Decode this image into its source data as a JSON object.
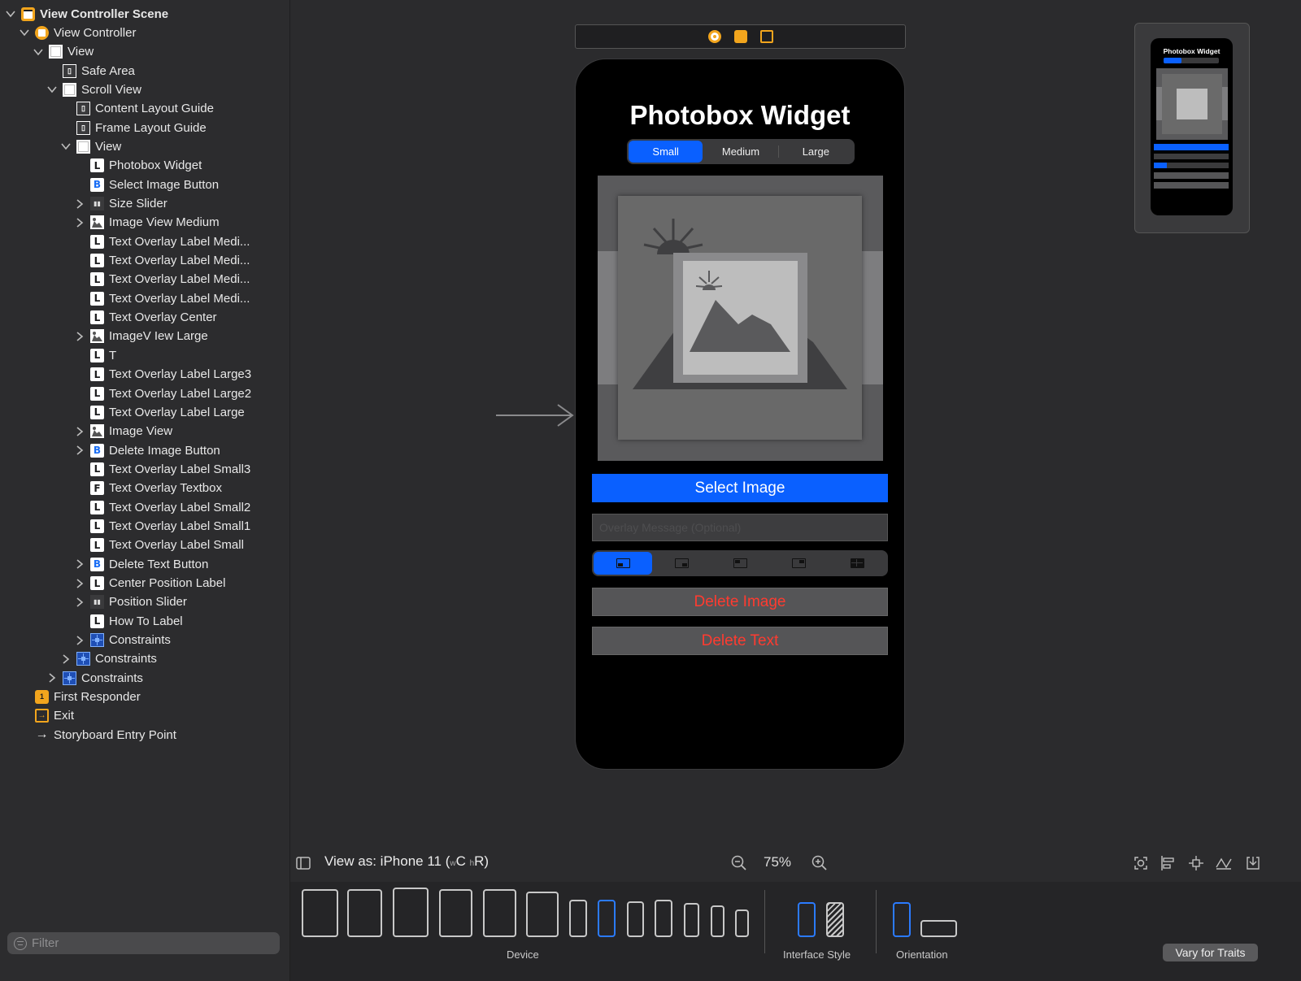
{
  "outline": {
    "items": [
      {
        "label": "View Controller Scene",
        "icon": "scene-icon",
        "kind": "scene",
        "depth": 0,
        "chevron": "down",
        "bold": true
      },
      {
        "label": "View Controller",
        "icon": "view-controller-icon",
        "kind": "vc",
        "depth": 1,
        "chevron": "down"
      },
      {
        "label": "View",
        "icon": "view-icon",
        "kind": "view",
        "depth": 2,
        "chevron": "down"
      },
      {
        "label": "Safe Area",
        "icon": "guide-icon",
        "kind": "guide",
        "depth": 3,
        "chevron": "none"
      },
      {
        "label": "Scroll View",
        "icon": "view-icon",
        "kind": "view",
        "depth": 3,
        "chevron": "down"
      },
      {
        "label": "Content Layout Guide",
        "icon": "guide-icon",
        "kind": "guide",
        "depth": 4,
        "chevron": "none"
      },
      {
        "label": "Frame Layout Guide",
        "icon": "guide-icon",
        "kind": "guide",
        "depth": 4,
        "chevron": "none"
      },
      {
        "label": "View",
        "icon": "view-icon",
        "kind": "view",
        "depth": 4,
        "chevron": "down"
      },
      {
        "label": "Photobox Widget",
        "icon": "label-icon",
        "kind": "label",
        "depth": 5,
        "chevron": "none"
      },
      {
        "label": "Select Image Button",
        "icon": "button-icon",
        "kind": "button",
        "depth": 5,
        "chevron": "none"
      },
      {
        "label": "Size Slider",
        "icon": "slider-icon",
        "kind": "slider",
        "depth": 5,
        "chevron": "right"
      },
      {
        "label": "Image View Medium",
        "icon": "image-view-icon",
        "kind": "imageview",
        "depth": 5,
        "chevron": "right"
      },
      {
        "label": "Text Overlay Label Medi...",
        "icon": "label-icon",
        "kind": "label",
        "depth": 5,
        "chevron": "none"
      },
      {
        "label": "Text Overlay Label Medi...",
        "icon": "label-icon",
        "kind": "label",
        "depth": 5,
        "chevron": "none"
      },
      {
        "label": "Text Overlay Label Medi...",
        "icon": "label-icon",
        "kind": "label",
        "depth": 5,
        "chevron": "none"
      },
      {
        "label": "Text Overlay Label Medi...",
        "icon": "label-icon",
        "kind": "label",
        "depth": 5,
        "chevron": "none"
      },
      {
        "label": "Text Overlay Center",
        "icon": "label-icon",
        "kind": "label",
        "depth": 5,
        "chevron": "none"
      },
      {
        "label": "ImageV Iew Large",
        "icon": "image-view-icon",
        "kind": "imageview",
        "depth": 5,
        "chevron": "right"
      },
      {
        "label": "T",
        "icon": "label-icon",
        "kind": "label",
        "depth": 5,
        "chevron": "none"
      },
      {
        "label": "Text Overlay Label Large3",
        "icon": "label-icon",
        "kind": "label",
        "depth": 5,
        "chevron": "none"
      },
      {
        "label": "Text Overlay Label Large2",
        "icon": "label-icon",
        "kind": "label",
        "depth": 5,
        "chevron": "none"
      },
      {
        "label": "Text Overlay Label Large",
        "icon": "label-icon",
        "kind": "label",
        "depth": 5,
        "chevron": "none"
      },
      {
        "label": "Image View",
        "icon": "image-view-icon",
        "kind": "imageview",
        "depth": 5,
        "chevron": "right"
      },
      {
        "label": "Delete Image Button",
        "icon": "button-icon",
        "kind": "button",
        "depth": 5,
        "chevron": "right"
      },
      {
        "label": "Text Overlay Label Small3",
        "icon": "label-icon",
        "kind": "label",
        "depth": 5,
        "chevron": "none"
      },
      {
        "label": "Text Overlay Textbox",
        "icon": "textfield-icon",
        "kind": "textfield",
        "depth": 5,
        "chevron": "none"
      },
      {
        "label": "Text Overlay Label Small2",
        "icon": "label-icon",
        "kind": "label",
        "depth": 5,
        "chevron": "none"
      },
      {
        "label": "Text Overlay Label Small1",
        "icon": "label-icon",
        "kind": "label",
        "depth": 5,
        "chevron": "none"
      },
      {
        "label": "Text Overlay Label Small",
        "icon": "label-icon",
        "kind": "label",
        "depth": 5,
        "chevron": "none"
      },
      {
        "label": "Delete Text Button",
        "icon": "button-icon",
        "kind": "button",
        "depth": 5,
        "chevron": "right"
      },
      {
        "label": "Center Position Label",
        "icon": "label-icon",
        "kind": "label",
        "depth": 5,
        "chevron": "right"
      },
      {
        "label": "Position Slider",
        "icon": "slider-icon",
        "kind": "slider",
        "depth": 5,
        "chevron": "right"
      },
      {
        "label": "How To Label",
        "icon": "label-icon",
        "kind": "label",
        "depth": 5,
        "chevron": "none"
      },
      {
        "label": "Constraints",
        "icon": "constraints-icon",
        "kind": "constraints",
        "depth": 5,
        "chevron": "right"
      },
      {
        "label": "Constraints",
        "icon": "constraints-icon",
        "kind": "constraints",
        "depth": 4,
        "chevron": "right"
      },
      {
        "label": "Constraints",
        "icon": "constraints-icon",
        "kind": "constraints",
        "depth": 3,
        "chevron": "right"
      },
      {
        "label": "First Responder",
        "icon": "first-responder-icon",
        "kind": "responder",
        "depth": 1,
        "chevron": "none"
      },
      {
        "label": "Exit",
        "icon": "exit-icon",
        "kind": "exit",
        "depth": 1,
        "chevron": "none"
      },
      {
        "label": "Storyboard Entry Point",
        "icon": "entry-arrow-icon",
        "kind": "entry",
        "depth": 1,
        "chevron": "none"
      }
    ],
    "filter_placeholder": "Filter"
  },
  "phone": {
    "title": "Photobox Widget",
    "size_segments": [
      "Small",
      "Medium",
      "Large"
    ],
    "size_selected": "Small",
    "select_image_label": "Select Image",
    "overlay_placeholder": "Overlay Message (Optional)",
    "position_selected_index": 0,
    "delete_image_label": "Delete Image",
    "delete_text_label": "Delete Text"
  },
  "minimap": {
    "title": "Photobox Widget"
  },
  "bottom": {
    "view_as_prefix": "View as: iPhone 11 (",
    "view_as_w": "w",
    "view_as_c": "C ",
    "view_as_h": "h",
    "view_as_r": "R)",
    "zoom": "75%",
    "device_label": "Device",
    "interface_style_label": "Interface Style",
    "orientation_label": "Orientation",
    "vary_label": "Vary for Traits"
  },
  "colors": {
    "accent": "#0a60ff",
    "destructive": "#ff3b30",
    "scene_icon": "#f2a51d"
  }
}
